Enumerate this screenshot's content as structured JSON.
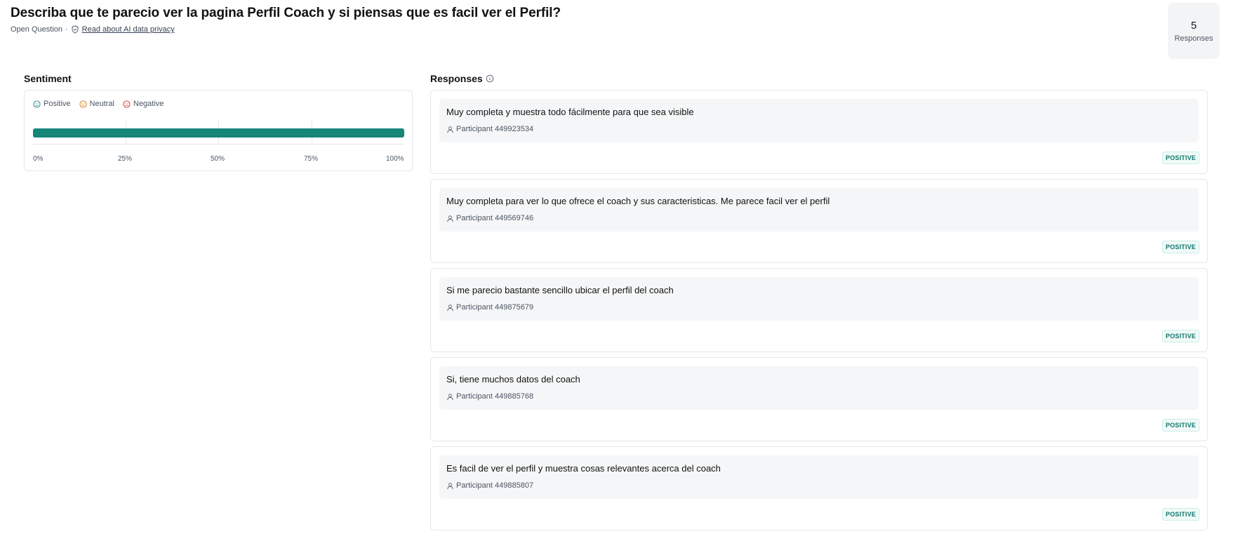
{
  "header": {
    "title": "Describa que te parecio ver la pagina Perfil Coach y si piensas que es facil ver el Perfil?",
    "question_type": "Open Question",
    "separator": "·",
    "privacy_link": "Read about AI data privacy",
    "privacy_icon": "shield-check-icon"
  },
  "summary": {
    "count": "5",
    "count_label": "Responses"
  },
  "sentiment": {
    "title": "Sentiment",
    "legend": [
      {
        "label": "Positive",
        "icon": "smile-face-icon",
        "color": "#16857a"
      },
      {
        "label": "Neutral",
        "icon": "neutral-face-icon",
        "color": "#d97706"
      },
      {
        "label": "Negative",
        "icon": "frown-face-icon",
        "color": "#dc2626"
      }
    ],
    "bar": {
      "positive_fraction": 1.0,
      "neutral_fraction": 0.0,
      "negative_fraction": 0.0
    },
    "ticks": [
      "0%",
      "25%",
      "50%",
      "75%",
      "100%"
    ]
  },
  "responses": {
    "title": "Responses",
    "info_icon": "info-circle-icon",
    "items": [
      {
        "text": "Muy completa y muestra todo fácilmente para que sea visible",
        "participant": "Participant 449923534",
        "badge": "POSITIVE"
      },
      {
        "text": "Muy completa para ver lo que ofrece el coach y sus caracteristicas. Me parece facil ver el perfil",
        "participant": "Participant 449569746",
        "badge": "POSITIVE"
      },
      {
        "text": "Si me parecio bastante sencillo ubicar el perfil del coach",
        "participant": "Participant 449875679",
        "badge": "POSITIVE"
      },
      {
        "text": "Si, tiene muchos datos del coach",
        "participant": "Participant 449885768",
        "badge": "POSITIVE"
      },
      {
        "text": "Es facil de ver el perfil y muestra cosas relevantes acerca del coach",
        "participant": "Participant 449885807",
        "badge": "POSITIVE"
      }
    ]
  },
  "colors": {
    "accent": "#16857a",
    "badge_text": "#0f766e"
  }
}
